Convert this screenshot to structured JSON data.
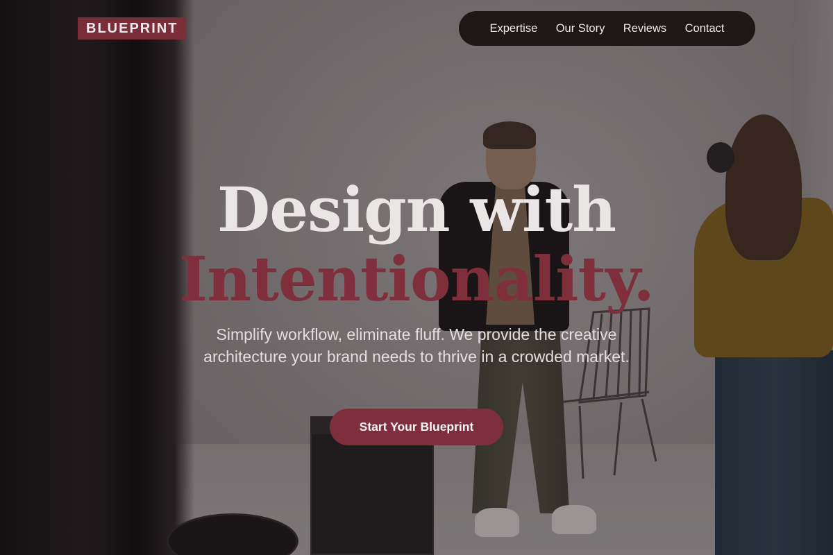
{
  "brand": {
    "logo_text": "BLUEPRINT",
    "accent_color": "#7f2f3b"
  },
  "nav": {
    "items": [
      {
        "label": "Expertise"
      },
      {
        "label": "Our Story"
      },
      {
        "label": "Reviews"
      },
      {
        "label": "Contact"
      }
    ]
  },
  "hero": {
    "headline_line1": "Design with",
    "headline_line2": "Intentionality.",
    "subtitle": "Simplify workflow, eliminate fluff. We provide the creative architecture your brand needs to thrive in a crowded market.",
    "cta_label": "Start Your Blueprint",
    "background_image": "photo-studio-photoshoot-scene"
  }
}
